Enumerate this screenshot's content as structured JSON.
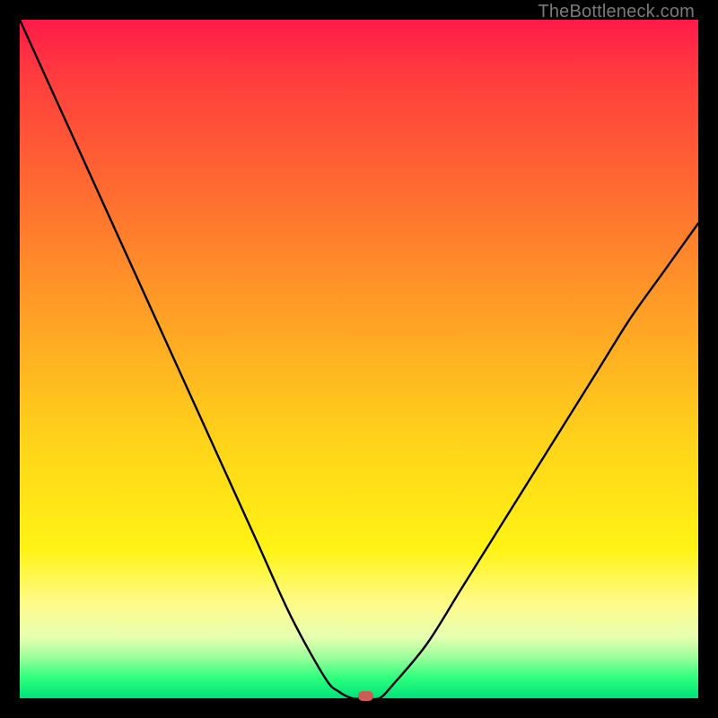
{
  "watermark": "TheBottleneck.com",
  "colors": {
    "frame": "#000000",
    "gradient_top": "#ff1a49",
    "gradient_mid1": "#ffa425",
    "gradient_mid2": "#fff314",
    "gradient_bottom": "#00e27a",
    "curve": "#000000",
    "marker": "#cd5b56"
  },
  "chart_data": {
    "type": "line",
    "title": "",
    "xlabel": "",
    "ylabel": "",
    "xlim": [
      0,
      100
    ],
    "ylim": [
      0,
      100
    ],
    "x": [
      0,
      5,
      10,
      15,
      20,
      25,
      30,
      35,
      40,
      45,
      47,
      49,
      51,
      53,
      55,
      60,
      65,
      70,
      75,
      80,
      85,
      90,
      95,
      100
    ],
    "values": [
      100,
      89,
      78,
      67,
      56,
      45,
      34,
      23,
      12,
      3,
      1,
      0,
      0,
      0,
      2,
      8,
      16,
      24,
      32,
      40,
      48,
      56,
      63,
      70
    ],
    "marker": {
      "x": 51,
      "y": 0
    },
    "notes": "V-shaped bottleneck curve; minimum (0) around x≈49–53. Left branch steeper than right. Background is a vertical red→green heat gradient (red=high bottleneck, green=low)."
  }
}
